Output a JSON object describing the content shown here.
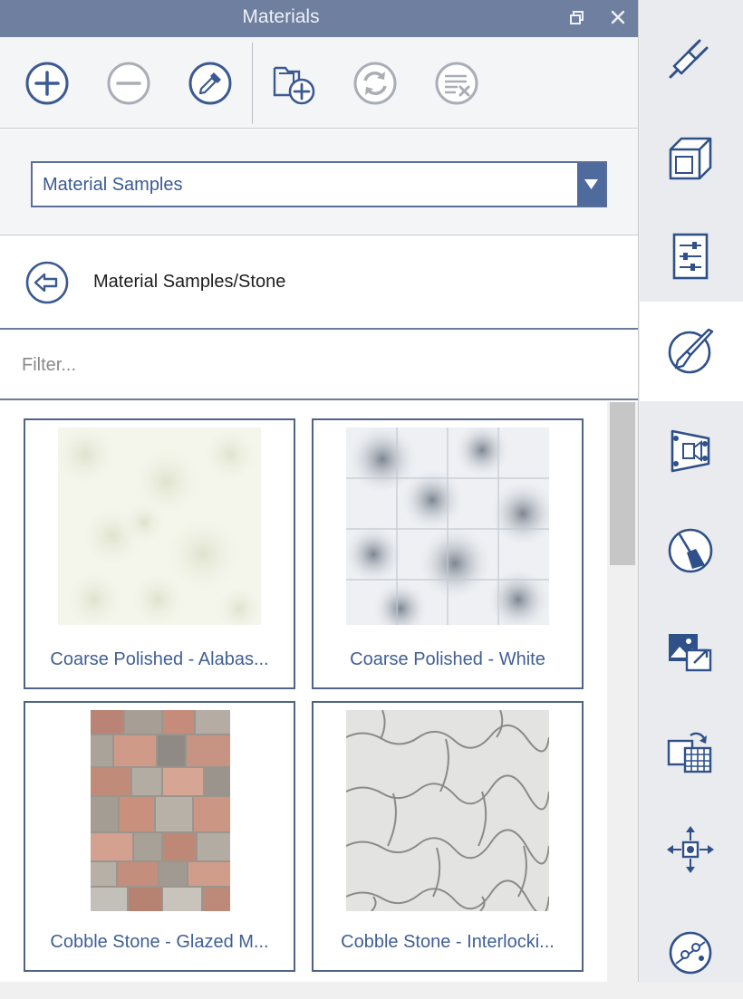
{
  "window": {
    "title": "Materials"
  },
  "toolbar": {
    "buttons": [
      {
        "name": "add-material-button",
        "icon": "plus-circle-icon"
      },
      {
        "name": "remove-material-button",
        "icon": "minus-circle-icon"
      },
      {
        "name": "eyedropper-button",
        "icon": "eyedropper-icon"
      },
      {
        "name": "new-library-button",
        "icon": "folder-add-icon"
      },
      {
        "name": "refresh-button",
        "icon": "refresh-icon"
      },
      {
        "name": "delete-library-button",
        "icon": "delete-list-icon"
      }
    ]
  },
  "library": {
    "selected": "Material Samples"
  },
  "path": {
    "text": "Material Samples/Stone"
  },
  "filter": {
    "placeholder": "Filter..."
  },
  "materials": [
    {
      "name": "Coarse Polished - Alabas..."
    },
    {
      "name": "Coarse Polished - White"
    },
    {
      "name": "Cobble Stone - Glazed M..."
    },
    {
      "name": "Cobble Stone - Interlocki..."
    }
  ],
  "sidebar": {
    "items": [
      {
        "icon": "plug-icon"
      },
      {
        "icon": "solid-box-icon"
      },
      {
        "icon": "properties-sliders-icon"
      },
      {
        "icon": "material-paint-icon",
        "active": true
      },
      {
        "icon": "clip-plane-icon"
      },
      {
        "icon": "broom-cleanup-icon"
      },
      {
        "icon": "image-export-icon"
      },
      {
        "icon": "texture-replace-icon"
      },
      {
        "icon": "move-transform-icon"
      },
      {
        "icon": "paint-bucket-icon"
      }
    ]
  },
  "colors": {
    "accent": "#4f6b9e",
    "titlebar": "#6f7fa0",
    "text_link": "#3f5f95"
  }
}
